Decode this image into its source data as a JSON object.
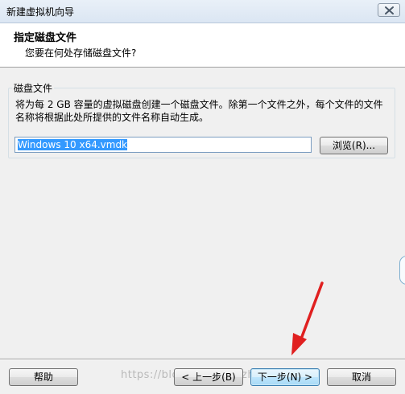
{
  "window": {
    "title": "新建虚拟机向导"
  },
  "header": {
    "title": "指定磁盘文件",
    "subtitle": "您要在何处存储磁盘文件?"
  },
  "disk_file": {
    "group_label": "磁盘文件",
    "description_line1": "将为每 2 GB 容量的虚拟磁盘创建一个磁盘文件。除第一个文件之外，每个文件的文件",
    "description_line2": "名称将根据此处所提供的文件名称自动生成。",
    "filename_value": "Windows 10 x64.vmdk",
    "browse_label": "浏览(R)..."
  },
  "footer": {
    "help_label": "帮助",
    "back_label": "< 上一步(B)",
    "next_label": "下一步(N) >",
    "cancel_label": "取消"
  },
  "watermark": {
    "text": "https://blog.csdn.net/zh  126"
  },
  "icons": {
    "close": "close-icon",
    "annotation": "red-arrow-icon"
  },
  "colors": {
    "selection": "#3399ff",
    "arrow": "#e02020",
    "focus_border": "#3c7fb1"
  }
}
